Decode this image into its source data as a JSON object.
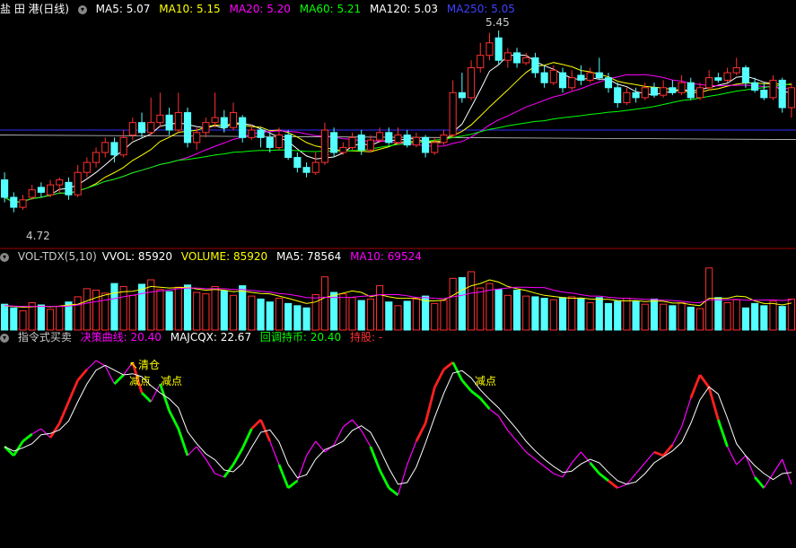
{
  "main_panel": {
    "title": "盐 田 港(日线)",
    "indicators": [
      {
        "text": "MA5: 5.07",
        "color": "#ffffff"
      },
      {
        "text": "MA10: 5.15",
        "color": "#ffff00"
      },
      {
        "text": "MA20: 5.20",
        "color": "#ff00ff"
      },
      {
        "text": "MA60: 5.21",
        "color": "#00ff00"
      },
      {
        "text": "MA120: 5.03",
        "color": "#ffffff"
      },
      {
        "text": "MA250: 5.05",
        "color": "#4040ff"
      }
    ],
    "high_label": "5.45",
    "low_label": "4.72"
  },
  "vol_panel": {
    "title": "VOL-TDX(5,10)",
    "indicators": [
      {
        "text": "VVOL: 85920",
        "color": "#ffffff"
      },
      {
        "text": "VOLUME: 85920",
        "color": "#ffff00"
      },
      {
        "text": "MA5: 78564",
        "color": "#ffffff"
      },
      {
        "text": "MA10: 69524",
        "color": "#ff00ff"
      }
    ]
  },
  "ind_panel": {
    "title": "指令式买卖",
    "indicators": [
      {
        "text": "决策曲线: 20.40",
        "color": "#ff00ff"
      },
      {
        "text": "MAJCQX: 22.67",
        "color": "#ffffff"
      },
      {
        "text": "回调持币: 20.40",
        "color": "#00ff00"
      },
      {
        "text": "持股: -",
        "color": "#ff3030"
      }
    ],
    "annotations": [
      {
        "text": "↖清仓",
        "color": "#ffff00"
      },
      {
        "text": "减点",
        "color": "#ffff00"
      },
      {
        "text": "减点",
        "color": "#ffff00"
      },
      {
        "text": "减点",
        "color": "#ffff00"
      }
    ]
  },
  "chart_data": {
    "type": "candlestick",
    "price_range": [
      4.6,
      5.5
    ],
    "ref_lines": {
      "ma250": 5.05,
      "ma120": 5.03
    },
    "candles": [
      [
        4.85,
        4.78,
        4.88,
        4.76
      ],
      [
        4.78,
        4.74,
        4.8,
        4.72
      ],
      [
        4.74,
        4.77,
        4.79,
        4.73
      ],
      [
        4.78,
        4.81,
        4.83,
        4.77
      ],
      [
        4.82,
        4.8,
        4.84,
        4.78
      ],
      [
        4.79,
        4.83,
        4.85,
        4.78
      ],
      [
        4.83,
        4.85,
        4.86,
        4.8
      ],
      [
        4.84,
        4.79,
        4.86,
        4.77
      ],
      [
        4.79,
        4.88,
        4.91,
        4.78
      ],
      [
        4.88,
        4.92,
        4.94,
        4.86
      ],
      [
        4.92,
        4.96,
        4.98,
        4.9
      ],
      [
        4.96,
        5.0,
        5.02,
        4.94
      ],
      [
        5.0,
        4.95,
        5.02,
        4.92
      ],
      [
        4.95,
        5.02,
        5.05,
        4.94
      ],
      [
        5.03,
        5.08,
        5.1,
        5.01
      ],
      [
        5.08,
        5.04,
        5.12,
        5.02
      ],
      [
        5.04,
        5.08,
        5.18,
        5.03
      ],
      [
        5.08,
        5.11,
        5.2,
        5.06
      ],
      [
        5.11,
        5.05,
        5.14,
        5.03
      ],
      [
        5.05,
        5.12,
        5.2,
        5.04
      ],
      [
        5.12,
        5.0,
        5.14,
        4.98
      ],
      [
        5.0,
        5.04,
        5.06,
        4.97
      ],
      [
        5.04,
        5.08,
        5.1,
        5.02
      ],
      [
        5.08,
        5.1,
        5.2,
        5.06
      ],
      [
        5.1,
        5.06,
        5.13,
        5.04
      ],
      [
        5.06,
        5.12,
        5.16,
        5.05
      ],
      [
        5.1,
        5.02,
        5.11,
        5.0
      ],
      [
        5.02,
        5.05,
        5.07,
        5.01
      ],
      [
        5.05,
        5.02,
        5.06,
        4.98
      ],
      [
        5.02,
        4.98,
        5.04,
        4.96
      ],
      [
        4.98,
        5.03,
        5.06,
        4.97
      ],
      [
        5.03,
        4.94,
        5.05,
        4.93
      ],
      [
        4.94,
        4.9,
        4.96,
        4.88
      ],
      [
        4.9,
        4.88,
        4.92,
        4.86
      ],
      [
        4.88,
        4.92,
        4.96,
        4.87
      ],
      [
        4.92,
        5.05,
        5.08,
        4.91
      ],
      [
        5.04,
        4.96,
        5.06,
        4.94
      ],
      [
        4.96,
        4.98,
        5.0,
        4.95
      ],
      [
        4.98,
        5.02,
        5.04,
        4.97
      ],
      [
        5.03,
        4.97,
        5.05,
        4.95
      ],
      [
        4.97,
        5.01,
        5.03,
        4.96
      ],
      [
        5.01,
        5.04,
        5.06,
        5.0
      ],
      [
        5.04,
        5.0,
        5.06,
        4.99
      ],
      [
        5.0,
        5.03,
        5.06,
        4.99
      ],
      [
        5.03,
        4.99,
        5.05,
        4.98
      ],
      [
        4.99,
        5.02,
        5.04,
        4.98
      ],
      [
        5.02,
        4.96,
        5.03,
        4.94
      ],
      [
        4.96,
        5.0,
        5.02,
        4.95
      ],
      [
        5.0,
        5.03,
        5.05,
        4.99
      ],
      [
        5.03,
        5.2,
        5.25,
        5.02
      ],
      [
        5.2,
        5.18,
        5.28,
        5.16
      ],
      [
        5.18,
        5.3,
        5.33,
        5.17
      ],
      [
        5.3,
        5.35,
        5.4,
        5.28
      ],
      [
        5.35,
        5.4,
        5.44,
        5.33
      ],
      [
        5.42,
        5.33,
        5.45,
        5.31
      ],
      [
        5.33,
        5.36,
        5.38,
        5.3
      ],
      [
        5.36,
        5.32,
        5.38,
        5.3
      ],
      [
        5.32,
        5.34,
        5.36,
        5.31
      ],
      [
        5.34,
        5.28,
        5.36,
        5.26
      ],
      [
        5.28,
        5.24,
        5.31,
        5.22
      ],
      [
        5.24,
        5.29,
        5.31,
        5.23
      ],
      [
        5.28,
        5.22,
        5.3,
        5.2
      ],
      [
        5.22,
        5.26,
        5.29,
        5.21
      ],
      [
        5.27,
        5.25,
        5.31,
        5.23
      ],
      [
        5.25,
        5.28,
        5.3,
        5.24
      ],
      [
        5.28,
        5.26,
        5.34,
        5.25
      ],
      [
        5.26,
        5.22,
        5.28,
        5.2
      ],
      [
        5.22,
        5.16,
        5.24,
        5.14
      ],
      [
        5.16,
        5.2,
        5.22,
        5.15
      ],
      [
        5.2,
        5.18,
        5.22,
        5.16
      ],
      [
        5.18,
        5.22,
        5.24,
        5.17
      ],
      [
        5.22,
        5.19,
        5.24,
        5.18
      ],
      [
        5.19,
        5.22,
        5.25,
        5.18
      ],
      [
        5.22,
        5.2,
        5.25,
        5.19
      ],
      [
        5.2,
        5.24,
        5.27,
        5.19
      ],
      [
        5.24,
        5.18,
        5.26,
        5.17
      ],
      [
        5.18,
        5.22,
        5.24,
        5.17
      ],
      [
        5.22,
        5.26,
        5.29,
        5.21
      ],
      [
        5.26,
        5.25,
        5.28,
        5.24
      ],
      [
        5.25,
        5.28,
        5.3,
        5.24
      ],
      [
        5.28,
        5.3,
        5.34,
        5.27
      ],
      [
        5.3,
        5.24,
        5.31,
        5.22
      ],
      [
        5.24,
        5.21,
        5.26,
        5.2
      ],
      [
        5.21,
        5.18,
        5.24,
        5.17
      ],
      [
        5.18,
        5.25,
        5.27,
        5.17
      ],
      [
        5.25,
        5.14,
        5.26,
        5.12
      ],
      [
        5.14,
        5.22,
        5.24,
        5.1
      ]
    ],
    "volume": [
      7.0,
      6.0,
      5.2,
      7.4,
      6.8,
      5.6,
      6.4,
      7.6,
      9.0,
      11.2,
      10.8,
      10.0,
      12.6,
      11.8,
      9.4,
      12.4,
      13.6,
      11.0,
      10.4,
      11.6,
      12.2,
      10.2,
      9.8,
      11.8,
      10.6,
      9.4,
      12.0,
      9.2,
      8.4,
      7.6,
      8.6,
      7.2,
      6.6,
      6.0,
      9.6,
      14.4,
      10.2,
      9.8,
      8.8,
      8.0,
      8.4,
      12.0,
      7.6,
      6.6,
      7.8,
      8.4,
      9.2,
      7.2,
      8.0,
      14.0,
      14.2,
      15.8,
      11.4,
      12.6,
      11.0,
      9.4,
      10.8,
      9.2,
      9.0,
      8.6,
      8.2,
      8.8,
      9.0,
      8.6,
      7.4,
      8.8,
      7.2,
      7.8,
      8.6,
      7.8,
      7.0,
      8.4,
      7.0,
      6.6,
      7.4,
      6.2,
      5.8,
      16.8,
      8.8,
      7.4,
      8.2,
      6.0,
      7.2,
      6.6,
      7.8,
      6.4,
      8.4
    ],
    "vol_ma5": [
      6.5,
      6.4,
      6.2,
      6.3,
      6.5,
      6.3,
      6.5,
      6.8,
      7.0,
      7.9,
      8.8,
      9.5,
      10.0,
      10.4,
      10.5,
      11.0,
      11.8,
      11.6,
      11.4,
      11.5,
      11.6,
      11.1,
      10.8,
      11.0,
      10.8,
      10.4,
      10.6,
      10.2,
      9.9,
      9.8,
      9.2,
      8.6,
      7.9,
      7.2,
      7.6,
      8.8,
      9.4,
      10.0,
      10.6,
      10.2,
      9.0,
      9.6,
      9.0,
      8.6,
      8.6,
      8.6,
      7.9,
      7.9,
      8.1,
      9.4,
      10.8,
      12.0,
      12.6,
      13.6,
      13.0,
      11.8,
      11.2,
      10.7,
      10.0,
      9.4,
      9.1,
      8.8,
      8.6,
      8.7,
      8.4,
      8.3,
      8.3,
      8.0,
      7.9,
      8.0,
      7.7,
      7.9,
      7.8,
      7.3,
      7.3,
      6.9,
      6.6,
      8.6,
      8.6,
      8.6,
      9.2,
      9.0,
      7.9,
      7.2,
      7.2,
      6.8,
      7.3
    ],
    "vol_ma10": [
      6.6,
      6.5,
      6.4,
      6.4,
      6.4,
      6.4,
      6.4,
      6.5,
      6.8,
      7.3,
      7.7,
      8.1,
      8.5,
      9.0,
      9.4,
      9.9,
      10.3,
      10.6,
      10.8,
      11.2,
      11.4,
      11.4,
      11.2,
      11.2,
      11.2,
      11.0,
      11.0,
      10.7,
      10.5,
      10.3,
      9.9,
      9.7,
      9.3,
      8.8,
      8.7,
      8.9,
      8.8,
      8.8,
      8.9,
      9.1,
      9.3,
      9.6,
      9.6,
      9.6,
      9.3,
      8.8,
      8.8,
      8.6,
      8.5,
      9.0,
      9.4,
      10.0,
      10.3,
      10.8,
      11.1,
      11.4,
      11.6,
      11.6,
      11.5,
      11.5,
      10.8,
      10.3,
      10.0,
      9.6,
      9.2,
      9.2,
      8.9,
      8.7,
      8.6,
      8.5,
      8.3,
      8.3,
      8.1,
      8.0,
      7.8,
      7.5,
      7.4,
      8.2,
      8.2,
      8.2,
      8.3,
      8.1,
      8.1,
      8.1,
      8.2,
      8.0,
      8.2
    ],
    "ind_line": [
      45,
      40,
      48,
      52,
      55,
      50,
      58,
      70,
      82,
      88,
      93,
      90,
      80,
      85,
      92,
      75,
      70,
      80,
      65,
      55,
      40,
      45,
      38,
      30,
      28,
      35,
      44,
      55,
      60,
      48,
      35,
      22,
      26,
      40,
      48,
      42,
      46,
      56,
      60,
      54,
      45,
      32,
      22,
      18,
      35,
      48,
      58,
      78,
      88,
      92,
      82,
      76,
      72,
      66,
      62,
      54,
      48,
      42,
      38,
      34,
      30,
      28,
      36,
      42,
      36,
      30,
      26,
      22,
      24,
      30,
      36,
      42,
      40,
      46,
      56,
      72,
      85,
      78,
      60,
      45,
      35,
      40,
      28,
      22,
      30,
      38,
      24
    ],
    "ind_colors": "gggmmrrrrmmmgmrgmgggmmmmgggrrmggmmmmmmmmgggmmrrrrggggmmmmmmmmmmmggrmmmmrrmmrrrgmmmgmmmg"
  }
}
